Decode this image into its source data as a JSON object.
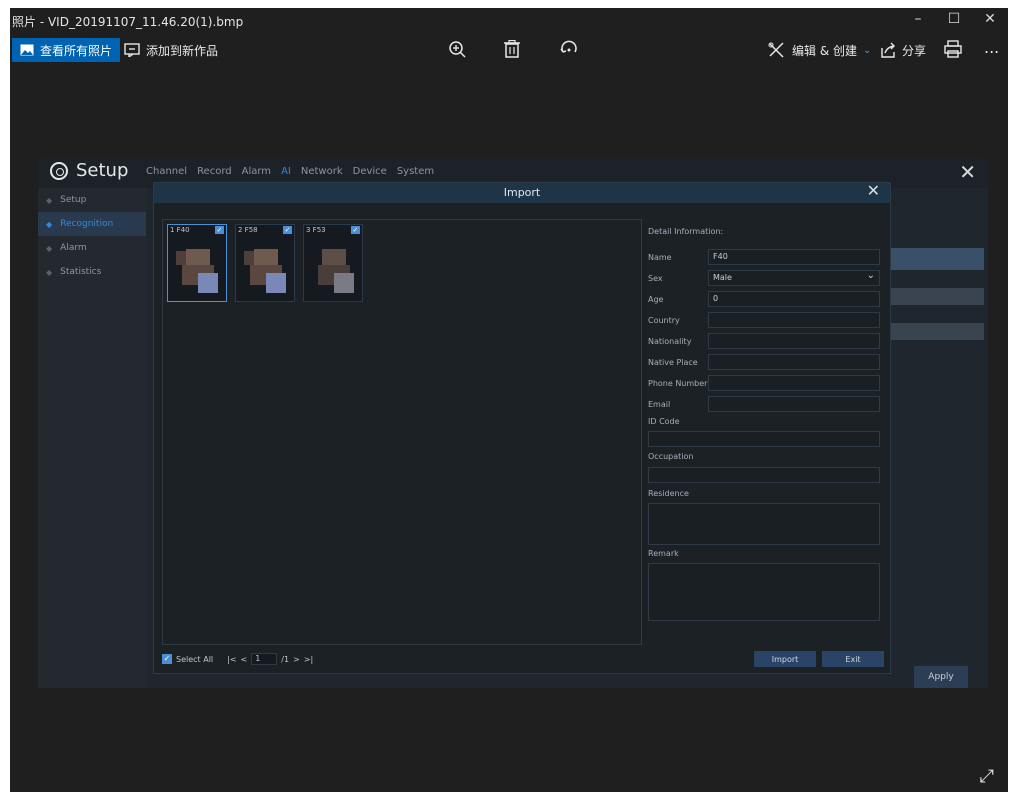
{
  "window": {
    "title": "照片 - VID_20191107_11.46.20(1).bmp",
    "controls": {
      "minimize": "–",
      "maximize": "☐",
      "close": "✕"
    }
  },
  "toolbar": {
    "view_all": "查看所有照片",
    "add_to_creation": "添加到新作品",
    "edit_create": "编辑 & 创建",
    "share": "分享",
    "more": "...",
    "icons": [
      "zoom-in-icon",
      "delete-icon",
      "rotate-icon",
      "edit-create-icon",
      "share-icon",
      "print-icon"
    ]
  },
  "nvr": {
    "title": "Setup",
    "tabs": [
      {
        "label": "Channel",
        "active": false
      },
      {
        "label": "Record",
        "active": false
      },
      {
        "label": "Alarm",
        "active": false
      },
      {
        "label": "AI",
        "active": true
      },
      {
        "label": "Network",
        "active": false
      },
      {
        "label": "Device",
        "active": false
      },
      {
        "label": "System",
        "active": false
      }
    ],
    "close": "✕",
    "sidebar": [
      {
        "label": "Setup",
        "active": false
      },
      {
        "label": "Recognition",
        "active": true
      },
      {
        "label": "Alarm",
        "active": false
      },
      {
        "label": "Statistics",
        "active": false
      }
    ],
    "apply": "Apply"
  },
  "dialog": {
    "title": "Import",
    "close": "✕",
    "photos": [
      {
        "label": "1 F40",
        "selected": true
      },
      {
        "label": "2 F58",
        "selected": true
      },
      {
        "label": "3 F53",
        "selected": true
      }
    ],
    "detail_title": "Detail Information:",
    "fields": {
      "name": {
        "label": "Name",
        "value": "F40"
      },
      "sex": {
        "label": "Sex",
        "value": "Male"
      },
      "age": {
        "label": "Age",
        "value": "0"
      },
      "country": {
        "label": "Country",
        "value": ""
      },
      "nationality": {
        "label": "Nationality",
        "value": ""
      },
      "native_place": {
        "label": "Native Place",
        "value": ""
      },
      "phone": {
        "label": "Phone Number",
        "value": ""
      },
      "email": {
        "label": "Email",
        "value": ""
      },
      "id_code": {
        "label": "ID Code",
        "value": ""
      },
      "occupation": {
        "label": "Occupation",
        "value": ""
      },
      "residence": {
        "label": "Residence",
        "value": ""
      },
      "remark": {
        "label": "Remark",
        "value": ""
      }
    },
    "footer": {
      "select_all": "Select All",
      "first": "|<",
      "prev": "<",
      "page": "1",
      "total": "/1",
      "next": ">",
      "last": ">|"
    },
    "import": "Import",
    "exit": "Exit"
  },
  "colors": {
    "accent": "#0063b1",
    "nvr_accent": "#2f8be0"
  }
}
